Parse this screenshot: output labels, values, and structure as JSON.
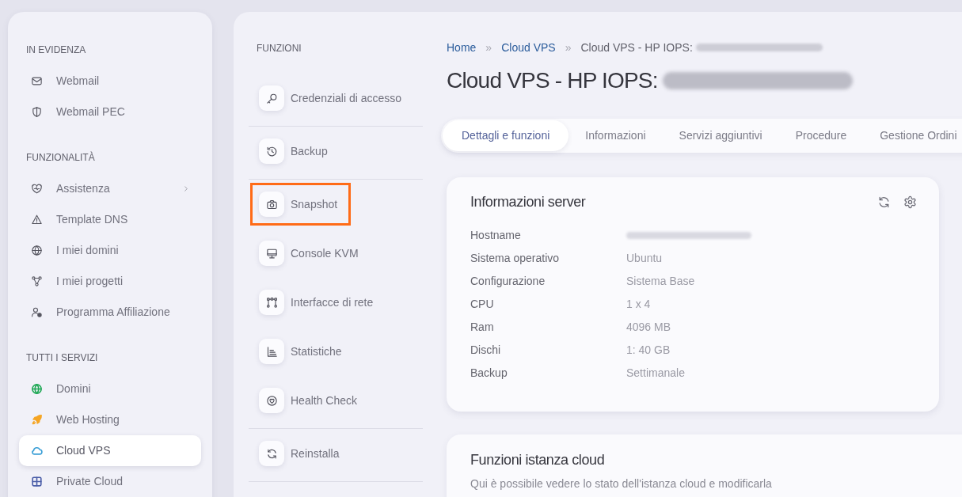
{
  "sidebar": {
    "sections": [
      {
        "heading": "IN EVIDENZA",
        "items": [
          {
            "label": "Webmail",
            "selected": false
          },
          {
            "label": "Webmail PEC",
            "selected": false
          }
        ]
      },
      {
        "heading": "FUNZIONALITÀ",
        "items": [
          {
            "label": "Assistenza",
            "selected": false,
            "expandable": true
          },
          {
            "label": "Template DNS",
            "selected": false,
            "expandable": false
          },
          {
            "label": "I miei domini",
            "selected": false,
            "expandable": false
          },
          {
            "label": "I miei progetti",
            "selected": false,
            "expandable": false
          },
          {
            "label": "Programma Affiliazione",
            "selected": false,
            "expandable": false
          }
        ]
      },
      {
        "heading": "TUTTI I SERVIZI",
        "items": [
          {
            "label": "Domini",
            "selected": false,
            "color": "#1fa855"
          },
          {
            "label": "Web Hosting",
            "selected": false,
            "color": "#f5a524"
          },
          {
            "label": "Cloud VPS",
            "selected": true,
            "color": "#3b9fd6"
          },
          {
            "label": "Private Cloud",
            "selected": false,
            "color": "#4b5ea8"
          }
        ]
      }
    ]
  },
  "functions": {
    "heading": "FUNZIONI",
    "groups": [
      {
        "items": [
          {
            "label": "Credenziali di accesso",
            "highlighted": false
          }
        ]
      },
      {
        "items": [
          {
            "label": "Backup",
            "highlighted": false
          }
        ]
      },
      {
        "items": [
          {
            "label": "Snapshot",
            "highlighted": true
          },
          {
            "label": "Console KVM",
            "highlighted": false
          },
          {
            "label": "Interfacce di rete",
            "highlighted": false
          },
          {
            "label": "Statistiche",
            "highlighted": false
          },
          {
            "label": "Health Check",
            "highlighted": false
          }
        ]
      },
      {
        "items": [
          {
            "label": "Reinstalla",
            "highlighted": false
          }
        ]
      }
    ]
  },
  "breadcrumb": [
    {
      "label": "Home",
      "kind": "link"
    },
    {
      "label": "Cloud VPS",
      "kind": "link",
      "separator": "»"
    },
    {
      "label": "Cloud VPS - HP IOPS:",
      "kind": "current",
      "separator": "»",
      "redacted": true
    }
  ],
  "title": {
    "text": "Cloud VPS - HP IOPS:",
    "redacted": true
  },
  "tabs": [
    {
      "label": "Dettagli e funzioni",
      "selected": true
    },
    {
      "label": "Informazioni",
      "selected": false
    },
    {
      "label": "Servizi aggiuntivi",
      "selected": false
    },
    {
      "label": "Procedure",
      "selected": false
    },
    {
      "label": "Gestione Ordini",
      "selected": false
    }
  ],
  "server_info": {
    "title": "Informazioni server",
    "rows": [
      {
        "label": "Hostname",
        "redacted": true
      },
      {
        "label": "Sistema operativo",
        "value": "Ubuntu"
      },
      {
        "label": "Configurazione",
        "value": "Sistema Base"
      },
      {
        "label": "CPU",
        "value": "1 x 4"
      },
      {
        "label": "Ram",
        "value": "4096 MB"
      },
      {
        "label": "Dischi",
        "value": "1: 40 GB"
      },
      {
        "label": "Backup",
        "value": "Settimanale"
      }
    ]
  },
  "cloud_functions": {
    "title": "Funzioni istanza cloud",
    "description": "Qui è possibile vedere lo stato dell'istanza cloud e modificarla"
  }
}
